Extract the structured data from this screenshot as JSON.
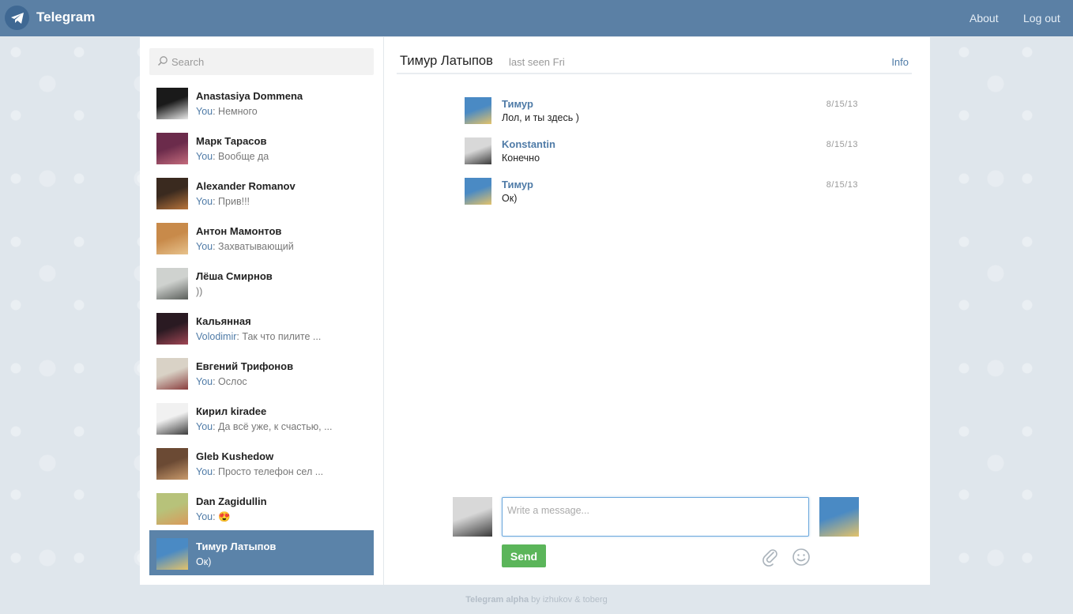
{
  "header": {
    "brand": "Telegram",
    "nav": {
      "about": "About",
      "logout": "Log out"
    }
  },
  "search": {
    "placeholder": "Search"
  },
  "dialogs": [
    {
      "name": "Anastasiya Dommena",
      "from": "You",
      "text": "Немного",
      "avatar_colors": [
        "#1a1a1a",
        "#e9e9e9"
      ]
    },
    {
      "name": "Марк Тарасов",
      "from": "You",
      "text": "Вообще да",
      "avatar_colors": [
        "#6b2b4b",
        "#c46b7c"
      ]
    },
    {
      "name": "Alexander Romanov",
      "from": "You",
      "text": "Прив!!!",
      "avatar_colors": [
        "#3a2a1f",
        "#b8743a"
      ]
    },
    {
      "name": "Антон Мамонтов",
      "from": "You",
      "text": "Захватывающий",
      "avatar_colors": [
        "#c88a4a",
        "#e7c28c"
      ]
    },
    {
      "name": "Лёша Смирнов",
      "from": "",
      "text": "))",
      "avatar_colors": [
        "#cfd2cf",
        "#5a5e5a"
      ]
    },
    {
      "name": "Кальянная",
      "from": "Volodimir",
      "text": "Так что пилите ...",
      "avatar_colors": [
        "#2a1a22",
        "#a04654"
      ]
    },
    {
      "name": "Евгений Трифонов",
      "from": "You",
      "text": "Ослос",
      "avatar_colors": [
        "#d9d2c6",
        "#8a3d3d"
      ]
    },
    {
      "name": "Кирил kiradee",
      "from": "You",
      "text": "Да всё уже, к счастью, ...",
      "avatar_colors": [
        "#f1f1f1",
        "#3c3c3c"
      ]
    },
    {
      "name": "Gleb Kushedow",
      "from": "You",
      "text": "Просто телефон сел ...",
      "avatar_colors": [
        "#6b4a34",
        "#c99a6b"
      ]
    },
    {
      "name": "Dan Zagidullin",
      "from": "You",
      "text": "😍",
      "avatar_colors": [
        "#b7c27a",
        "#d99a5a"
      ]
    },
    {
      "name": "Тимур Латыпов",
      "from": "",
      "text": "Ок)",
      "avatar_colors": [
        "#4a8ac4",
        "#e4c36a"
      ],
      "active": true
    }
  ],
  "chat": {
    "peer_name": "Тимур Латыпов",
    "peer_status": "last seen Fri",
    "info_link": "Info",
    "messages": [
      {
        "author": "Тимур",
        "text": "Лол, и ты здесь )",
        "date": "8/15/13",
        "avatar_colors": [
          "#4a8ac4",
          "#e4c36a"
        ]
      },
      {
        "author": "Konstantin",
        "text": "Конечно",
        "date": "8/15/13",
        "avatar_colors": [
          "#d8d8d8",
          "#3a3a3a"
        ]
      },
      {
        "author": "Тимур",
        "text": "Ок)",
        "date": "8/15/13",
        "avatar_colors": [
          "#4a8ac4",
          "#e4c36a"
        ]
      }
    ]
  },
  "composer": {
    "placeholder": "Write a message...",
    "send_label": "Send",
    "me_avatar_colors": [
      "#d8d8d8",
      "#3a3a3a"
    ],
    "peer_avatar_colors": [
      "#4a8ac4",
      "#e4c36a"
    ]
  },
  "footer": {
    "brand": "Telegram alpha",
    "credit": " by izhukov & toberg"
  },
  "colors": {
    "header": "#5b80a5",
    "accent": "#4f7ba7",
    "send": "#5bb55a",
    "active_dialog": "#5b83a9"
  }
}
